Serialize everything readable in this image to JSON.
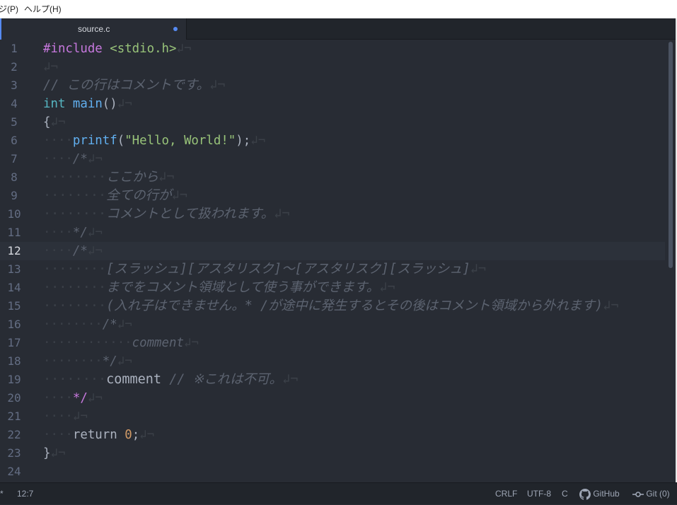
{
  "menubar": {
    "items": [
      "ジ(P)",
      "ヘルプ(H)"
    ]
  },
  "tab": {
    "title": "source.c",
    "modified": true
  },
  "colors": {
    "accent": "#568af2",
    "background": "#282c34",
    "keyword": "#c678dd",
    "string": "#98c379",
    "function": "#61afef",
    "comment": "#5c6370",
    "number": "#d19a66"
  },
  "editor": {
    "cursor_line": 12,
    "lines": [
      {
        "num": "1",
        "tokens": [
          {
            "t": "#include",
            "c": "kw"
          },
          {
            "t": " ",
            "c": "plain"
          },
          {
            "t": "<stdio.h>",
            "c": "str"
          },
          {
            "t": "↲¬",
            "c": "ws"
          }
        ]
      },
      {
        "num": "2",
        "tokens": [
          {
            "t": "↲¬",
            "c": "ws"
          }
        ]
      },
      {
        "num": "3",
        "tokens": [
          {
            "t": "// この行はコメントです。",
            "c": "com"
          },
          {
            "t": "↲¬",
            "c": "ws"
          }
        ]
      },
      {
        "num": "4",
        "tokens": [
          {
            "t": "int",
            "c": "type"
          },
          {
            "t": " ",
            "c": "plain"
          },
          {
            "t": "main",
            "c": "fn"
          },
          {
            "t": "()",
            "c": "pun"
          },
          {
            "t": "↲¬",
            "c": "ws"
          }
        ]
      },
      {
        "num": "5",
        "tokens": [
          {
            "t": "{",
            "c": "pun"
          },
          {
            "t": "↲¬",
            "c": "ws"
          }
        ]
      },
      {
        "num": "6",
        "tokens": [
          {
            "t": "····",
            "c": "ws"
          },
          {
            "t": "printf",
            "c": "fn"
          },
          {
            "t": "(",
            "c": "pun"
          },
          {
            "t": "\"Hello, World!\"",
            "c": "str"
          },
          {
            "t": ");",
            "c": "pun"
          },
          {
            "t": "↲¬",
            "c": "ws"
          }
        ]
      },
      {
        "num": "7",
        "tokens": [
          {
            "t": "····",
            "c": "ws"
          },
          {
            "t": "/*",
            "c": "com"
          },
          {
            "t": "↲¬",
            "c": "ws"
          }
        ]
      },
      {
        "num": "8",
        "tokens": [
          {
            "t": "········",
            "c": "ws"
          },
          {
            "t": "ここから",
            "c": "com"
          },
          {
            "t": "↲¬",
            "c": "ws"
          }
        ]
      },
      {
        "num": "9",
        "tokens": [
          {
            "t": "········",
            "c": "ws"
          },
          {
            "t": "全ての行が",
            "c": "com"
          },
          {
            "t": "↲¬",
            "c": "ws"
          }
        ]
      },
      {
        "num": "10",
        "tokens": [
          {
            "t": "········",
            "c": "ws"
          },
          {
            "t": "コメントとして扱われます。",
            "c": "com"
          },
          {
            "t": "↲¬",
            "c": "ws"
          }
        ]
      },
      {
        "num": "11",
        "tokens": [
          {
            "t": "····",
            "c": "ws"
          },
          {
            "t": "*/",
            "c": "com"
          },
          {
            "t": "↲¬",
            "c": "ws"
          }
        ]
      },
      {
        "num": "12",
        "tokens": [
          {
            "t": "····",
            "c": "ws"
          },
          {
            "t": "/*",
            "c": "com"
          },
          {
            "t": "↲¬",
            "c": "ws"
          }
        ]
      },
      {
        "num": "13",
        "tokens": [
          {
            "t": "········",
            "c": "ws"
          },
          {
            "t": "[スラッシュ][アスタリスク]〜[アスタリスク][スラッシュ]",
            "c": "com"
          },
          {
            "t": "↲¬",
            "c": "ws"
          }
        ]
      },
      {
        "num": "14",
        "tokens": [
          {
            "t": "········",
            "c": "ws"
          },
          {
            "t": "までをコメント領域として使う事ができます。",
            "c": "com"
          },
          {
            "t": "↲¬",
            "c": "ws"
          }
        ]
      },
      {
        "num": "15",
        "tokens": [
          {
            "t": "········",
            "c": "ws"
          },
          {
            "t": "(入れ子はできません。* /が途中に発生するとその後はコメント領域から外れます)",
            "c": "com"
          },
          {
            "t": "↲¬",
            "c": "ws"
          }
        ]
      },
      {
        "num": "16",
        "tokens": [
          {
            "t": "········",
            "c": "ws"
          },
          {
            "t": "/*",
            "c": "com"
          },
          {
            "t": "↲¬",
            "c": "ws"
          }
        ]
      },
      {
        "num": "17",
        "tokens": [
          {
            "t": "············",
            "c": "ws"
          },
          {
            "t": "comment",
            "c": "com"
          },
          {
            "t": "↲¬",
            "c": "ws"
          }
        ]
      },
      {
        "num": "18",
        "tokens": [
          {
            "t": "········",
            "c": "ws"
          },
          {
            "t": "*/",
            "c": "com"
          },
          {
            "t": "↲¬",
            "c": "ws"
          }
        ]
      },
      {
        "num": "19",
        "tokens": [
          {
            "t": "········",
            "c": "ws"
          },
          {
            "t": "comment",
            "c": "plain"
          },
          {
            "t": " ",
            "c": "plain"
          },
          {
            "t": "// ※これは不可。",
            "c": "com"
          },
          {
            "t": "↲¬",
            "c": "ws"
          }
        ]
      },
      {
        "num": "20",
        "tokens": [
          {
            "t": "····",
            "c": "ws"
          },
          {
            "t": "*/",
            "c": "kwc"
          },
          {
            "t": "↲¬",
            "c": "ws"
          }
        ]
      },
      {
        "num": "21",
        "tokens": [
          {
            "t": "····",
            "c": "ws"
          },
          {
            "t": "↲¬",
            "c": "ws"
          }
        ]
      },
      {
        "num": "22",
        "tokens": [
          {
            "t": "····",
            "c": "ws"
          },
          {
            "t": "return",
            "c": "plain"
          },
          {
            "t": " ",
            "c": "plain"
          },
          {
            "t": "0",
            "c": "num"
          },
          {
            "t": ";",
            "c": "pun"
          },
          {
            "t": "↲¬",
            "c": "ws"
          }
        ]
      },
      {
        "num": "23",
        "tokens": [
          {
            "t": "}",
            "c": "pun"
          },
          {
            "t": "↲¬",
            "c": "ws"
          }
        ]
      },
      {
        "num": "24",
        "tokens": []
      }
    ]
  },
  "statusbar": {
    "left_marker": "*",
    "cursor_pos": "12:7",
    "line_ending": "CRLF",
    "encoding": "UTF-8",
    "grammar": "C",
    "github_label": "GitHub",
    "git_label": "Git (0)"
  }
}
